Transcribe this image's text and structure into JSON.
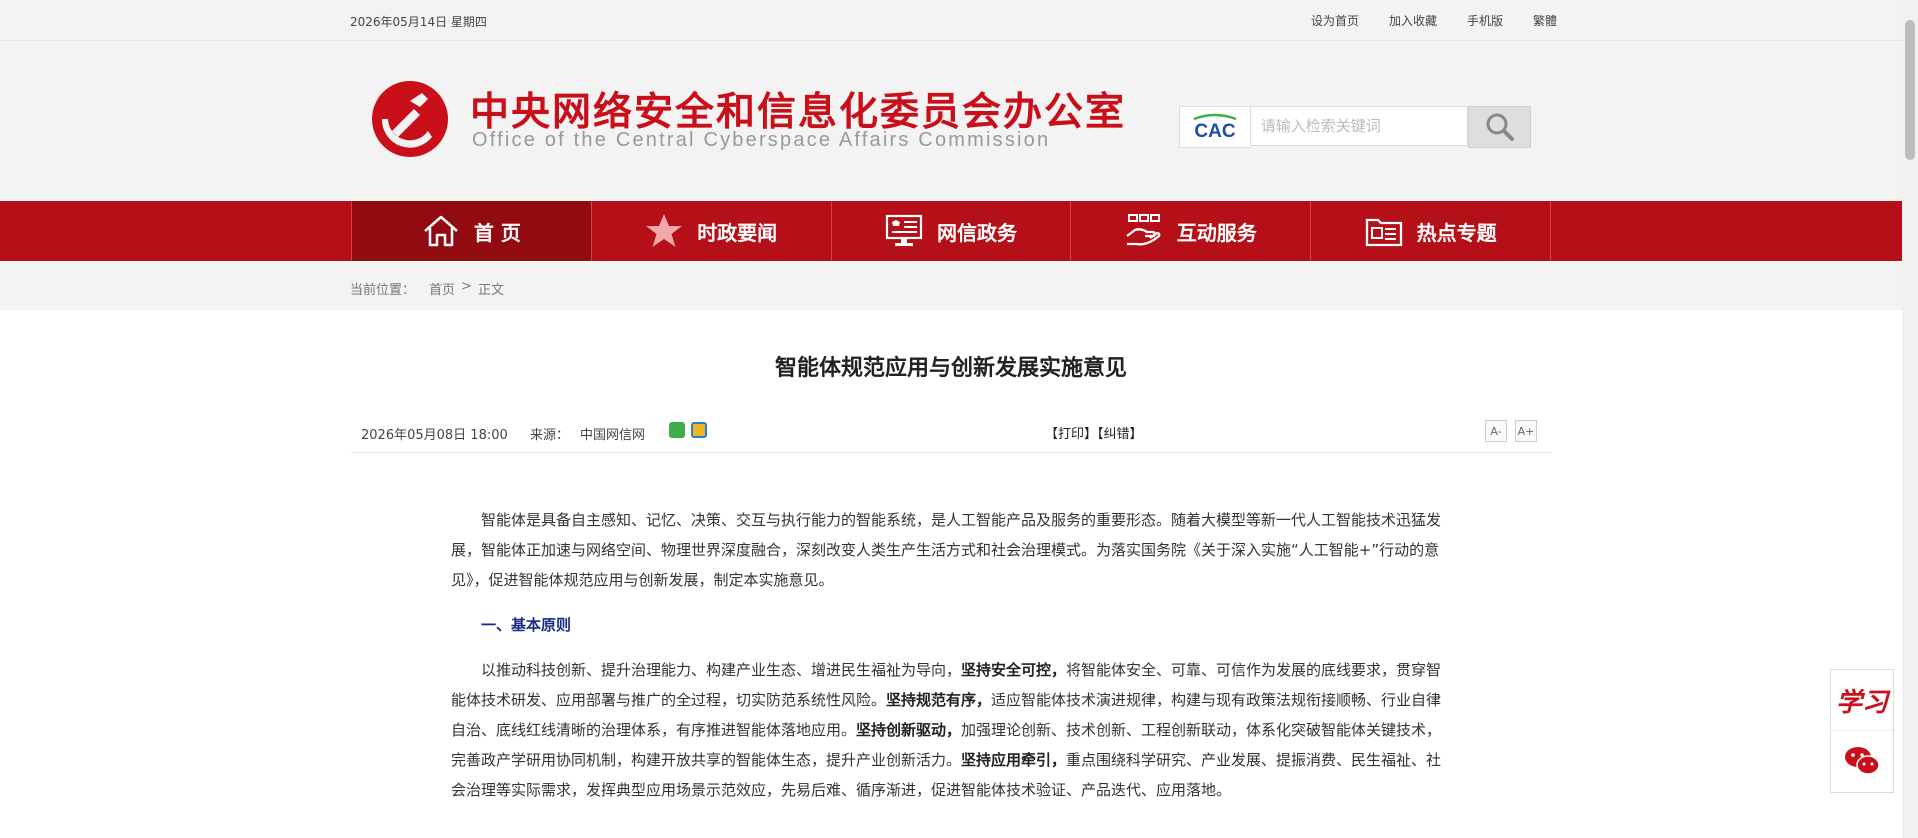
{
  "topbar": {
    "date": "2026年05月14日 星期四",
    "links": [
      "设为首页",
      "加入收藏",
      "手机版",
      "繁體"
    ]
  },
  "header": {
    "title_cn": "中央网络安全和信息化委员会办公室",
    "title_en": "Office of the Central Cyberspace Affairs Commission",
    "search_logo": "CAC",
    "search_placeholder": "请输入检索关键词"
  },
  "nav": [
    {
      "label": "首 页",
      "icon": "home-icon",
      "active": true
    },
    {
      "label": "时政要闻",
      "icon": "star-icon",
      "active": false
    },
    {
      "label": "网信政务",
      "icon": "monitor-icon",
      "active": false
    },
    {
      "label": "互动服务",
      "icon": "hand-service-icon",
      "active": false
    },
    {
      "label": "热点专题",
      "icon": "folder-icon",
      "active": false
    }
  ],
  "breadcrumb": {
    "label": "当前位置：",
    "home": "首页",
    "sep": ">",
    "current": "正文"
  },
  "article": {
    "title": "智能体规范应用与创新发展实施意见",
    "date": "2026年05月08日 18:00",
    "source_label": "来源：",
    "source": "中国网信网",
    "print": "【打印】",
    "correct": "【纠错】",
    "font_small": "A-",
    "font_large": "A+",
    "p1": "智能体是具备自主感知、记忆、决策、交互与执行能力的智能系统，是人工智能产品及服务的重要形态。随着大模型等新一代人工智能技术迅猛发展，智能体正加速与网络空间、物理世界深度融合，深刻改变人类生产生活方式和社会治理模式。为落实国务院《关于深入实施“人工智能+”行动的意见》，促进智能体规范应用与创新发展，制定本实施意见。",
    "h1": "一、基本原则",
    "p2_a": "以推动科技创新、提升治理能力、构建产业生态、增进民生福祉为导向，",
    "p2_b1": "坚持安全可控，",
    "p2_c": "将智能体安全、可靠、可信作为发展的底线要求，贯穿智能体技术研发、应用部署与推广的全过程，切实防范系统性风险。",
    "p2_b2": "坚持规范有序，",
    "p2_d": "适应智能体技术演进规律，构建与现有政策法规衔接顺畅、行业自律自治、底线红线清晰的治理体系，有序推进智能体落地应用。",
    "p2_b3": "坚持创新驱动，",
    "p2_e": "加强理论创新、技术创新、工程创新联动，体系化突破智能体关键技术，完善政产学研用协同机制，构建开放共享的智能体生态，提升产业创新活力。",
    "p2_b4": "坚持应用牵引，",
    "p2_f": "重点围绕科学研究、产业发展、提振消费、民生福祉、社会治理等实际需求，发挥典型应用场景示范效应，先易后难、循序渐进，促进智能体技术验证、产品迭代、应用落地。"
  },
  "float": {
    "xuexi": "学习"
  },
  "colors": {
    "brand_red": "#b50f17",
    "nav_active": "#920b10",
    "heading_blue": "#1a2d86"
  }
}
